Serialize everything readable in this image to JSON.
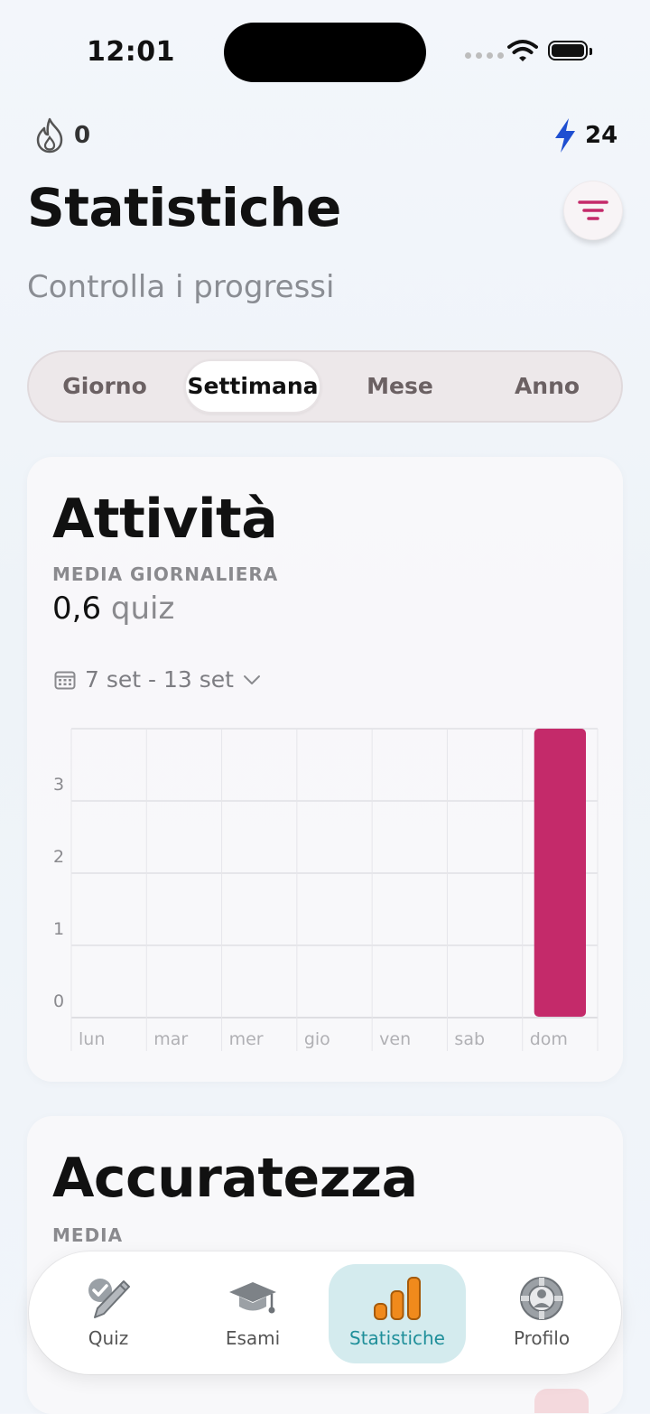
{
  "status_bar": {
    "time": "12:01"
  },
  "header": {
    "streak_count": "0",
    "energy_count": "24",
    "title": "Statistiche",
    "subtitle": "Controlla i progressi"
  },
  "period_tabs": [
    {
      "label": "Giorno",
      "active": false
    },
    {
      "label": "Settimana",
      "active": true
    },
    {
      "label": "Mese",
      "active": false
    },
    {
      "label": "Anno",
      "active": false
    }
  ],
  "activity_card": {
    "title": "Attività",
    "caption": "MEDIA GIORNALIERA",
    "average_value": "0,6",
    "average_unit": "quiz",
    "date_range": "7 set - 13 set"
  },
  "chart_data": {
    "type": "bar",
    "title": "",
    "xlabel": "",
    "ylabel": "",
    "categories": [
      "lun",
      "mar",
      "mer",
      "gio",
      "ven",
      "sab",
      "dom"
    ],
    "values": [
      0,
      0,
      0,
      0,
      0,
      0,
      4
    ],
    "yticks": [
      0,
      1,
      2,
      3
    ],
    "ylim": [
      0,
      4
    ],
    "bar_color": "#c42a6a",
    "grid": true
  },
  "accuracy_card": {
    "title": "Accuratezza",
    "caption": "MEDIA"
  },
  "tab_bar": [
    {
      "label": "Quiz",
      "icon": "pencil-check-icon",
      "active": false
    },
    {
      "label": "Esami",
      "icon": "graduation-cap-icon",
      "active": false
    },
    {
      "label": "Statistiche",
      "icon": "bar-chart-icon",
      "active": true
    },
    {
      "label": "Profilo",
      "icon": "profile-lifebuoy-icon",
      "active": false
    }
  ],
  "colors": {
    "accent": "#c42a6a",
    "energy": "#1f4fd1",
    "tab_active_bg": "#d4ebee",
    "tab_active_text": "#1f8f9a",
    "chart_icon": "#f08a1c"
  }
}
